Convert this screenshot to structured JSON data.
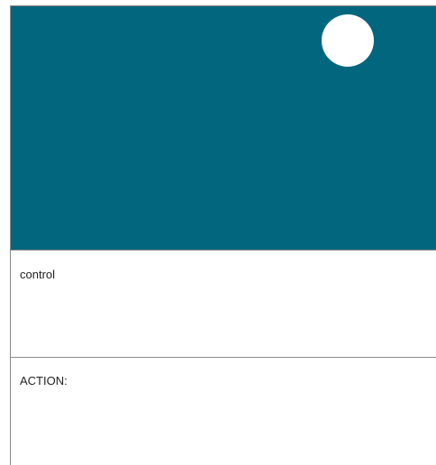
{
  "canvas": {
    "background_color": "#01667e",
    "marker_color": "#ffffff"
  },
  "control_section": {
    "label": "control"
  },
  "action_section": {
    "label": "ACTION:"
  }
}
